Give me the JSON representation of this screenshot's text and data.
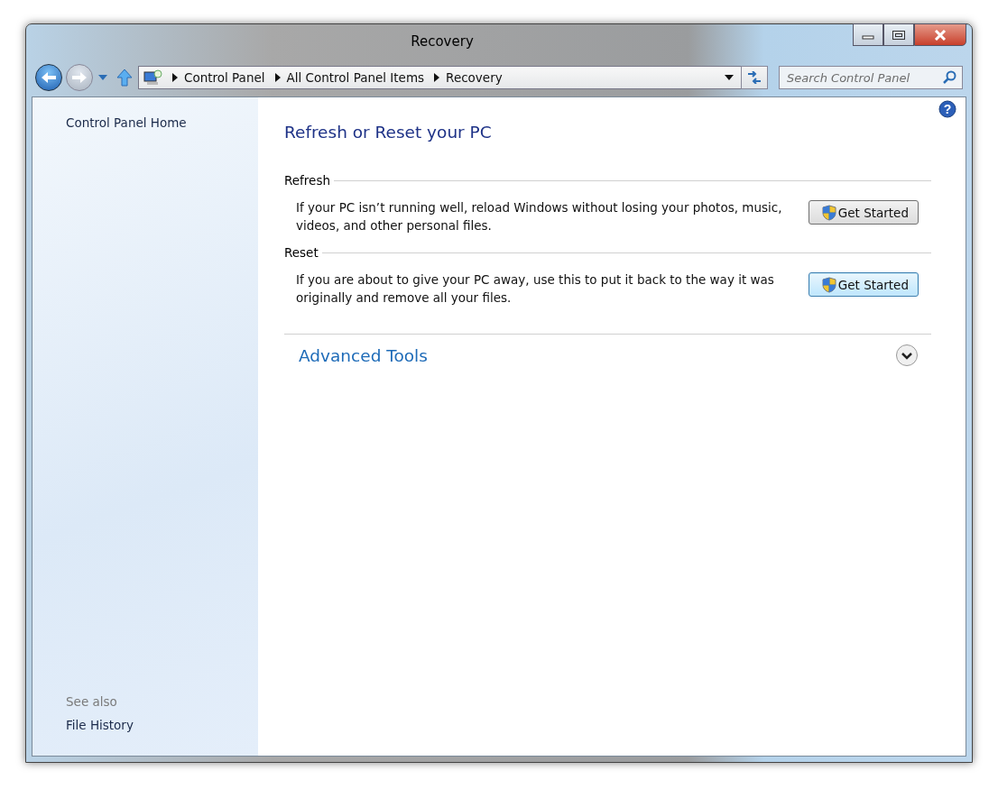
{
  "window": {
    "title": "Recovery"
  },
  "address_bar": {
    "crumbs": [
      "Control Panel",
      "All Control Panel Items",
      "Recovery"
    ]
  },
  "search": {
    "placeholder": "Search Control Panel"
  },
  "help": {
    "glyph": "?"
  },
  "sidebar": {
    "home": "Control Panel Home",
    "see_also_label": "See also",
    "see_also": [
      "File History"
    ]
  },
  "main": {
    "heading": "Refresh or Reset your PC",
    "sections": [
      {
        "title": "Refresh",
        "text": "If your PC isn’t running well, reload Windows without losing your photos, music, videos, and other personal files.",
        "button": "Get Started",
        "focused": false
      },
      {
        "title": "Reset",
        "text": "If you are about to give your PC away, use this to put it back to the way it was originally and remove all your files.",
        "button": "Get Started",
        "focused": true
      }
    ],
    "advanced": {
      "label": "Advanced Tools",
      "expanded": false
    }
  }
}
